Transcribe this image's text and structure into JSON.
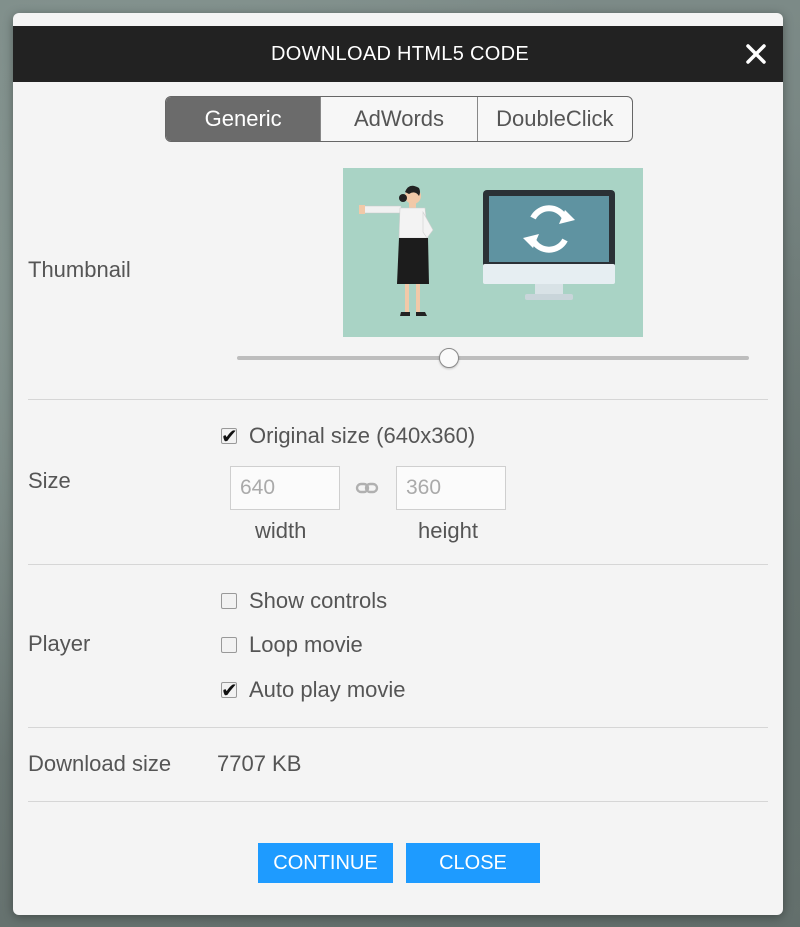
{
  "dialog": {
    "title": "DOWNLOAD HTML5 CODE",
    "close_icon": "close-icon"
  },
  "tabs": [
    {
      "label": "Generic",
      "active": true
    },
    {
      "label": "AdWords",
      "active": false
    },
    {
      "label": "DoubleClick",
      "active": false
    }
  ],
  "thumbnail": {
    "label": "Thumbnail",
    "slider_value_fraction": 0.41
  },
  "size": {
    "label": "Size",
    "original_size_label": "Original size (640x360)",
    "original_size_checked": true,
    "width_value": "640",
    "height_value": "360",
    "width_caption": "width",
    "height_caption": "height",
    "link_icon": "link-icon"
  },
  "player": {
    "label": "Player",
    "options": [
      {
        "label": "Show controls",
        "checked": false
      },
      {
        "label": "Loop movie",
        "checked": false
      },
      {
        "label": "Auto play movie",
        "checked": true
      }
    ]
  },
  "download": {
    "label": "Download size",
    "value": "7707 KB"
  },
  "buttons": {
    "continue": "CONTINUE",
    "close": "CLOSE"
  },
  "colors": {
    "accent": "#1e9bff",
    "titlebar": "#222222",
    "tab_active": "#6b6b6b",
    "thumbnail_bg": "#a9d3c5"
  }
}
